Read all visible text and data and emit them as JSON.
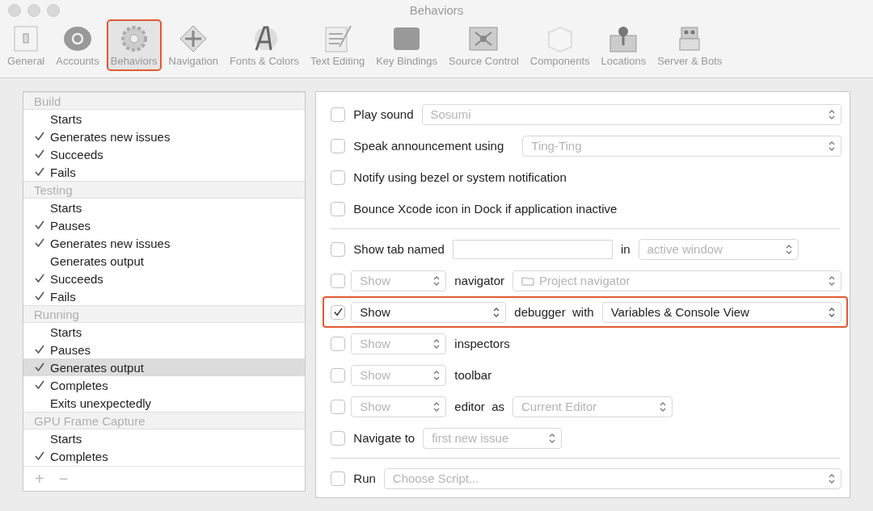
{
  "window": {
    "title": "Behaviors"
  },
  "toolbar": [
    {
      "label": "General",
      "selected": false,
      "highlighted": false
    },
    {
      "label": "Accounts",
      "selected": false,
      "highlighted": false
    },
    {
      "label": "Behaviors",
      "selected": true,
      "highlighted": true
    },
    {
      "label": "Navigation",
      "selected": false,
      "highlighted": false
    },
    {
      "label": "Fonts & Colors",
      "selected": false,
      "highlighted": false
    },
    {
      "label": "Text Editing",
      "selected": false,
      "highlighted": false
    },
    {
      "label": "Key Bindings",
      "selected": false,
      "highlighted": false
    },
    {
      "label": "Source Control",
      "selected": false,
      "highlighted": false
    },
    {
      "label": "Components",
      "selected": false,
      "highlighted": false
    },
    {
      "label": "Locations",
      "selected": false,
      "highlighted": false
    },
    {
      "label": "Server & Bots",
      "selected": false,
      "highlighted": false
    }
  ],
  "event_list": {
    "sections": [
      {
        "title": "Build",
        "items": [
          {
            "label": "Starts",
            "checked": false,
            "selected": false
          },
          {
            "label": "Generates new issues",
            "checked": true,
            "selected": false
          },
          {
            "label": "Succeeds",
            "checked": true,
            "selected": false
          },
          {
            "label": "Fails",
            "checked": true,
            "selected": false
          }
        ]
      },
      {
        "title": "Testing",
        "items": [
          {
            "label": "Starts",
            "checked": false,
            "selected": false
          },
          {
            "label": "Pauses",
            "checked": true,
            "selected": false
          },
          {
            "label": "Generates new issues",
            "checked": true,
            "selected": false
          },
          {
            "label": "Generates output",
            "checked": false,
            "selected": false
          },
          {
            "label": "Succeeds",
            "checked": true,
            "selected": false
          },
          {
            "label": "Fails",
            "checked": true,
            "selected": false
          }
        ]
      },
      {
        "title": "Running",
        "items": [
          {
            "label": "Starts",
            "checked": false,
            "selected": false
          },
          {
            "label": "Pauses",
            "checked": true,
            "selected": false
          },
          {
            "label": "Generates output",
            "checked": true,
            "selected": true
          },
          {
            "label": "Completes",
            "checked": true,
            "selected": false
          },
          {
            "label": "Exits unexpectedly",
            "checked": false,
            "selected": false
          }
        ]
      },
      {
        "title": "GPU Frame Capture",
        "items": [
          {
            "label": "Starts",
            "checked": false,
            "selected": false
          },
          {
            "label": "Completes",
            "checked": true,
            "selected": false
          }
        ]
      }
    ],
    "footer_buttons": [
      "+",
      "−"
    ]
  },
  "actions": [
    {
      "kind": "option",
      "checked": false,
      "highlighted": false,
      "parts": [
        {
          "kind": "label",
          "text": "Play sound"
        },
        {
          "kind": "popup",
          "value": "Sosumi",
          "enabled": false
        }
      ]
    },
    {
      "kind": "option",
      "checked": false,
      "highlighted": false,
      "parts": [
        {
          "kind": "label",
          "text": "Speak announcement using"
        },
        {
          "kind": "spacer"
        },
        {
          "kind": "popup",
          "value": "Ting-Ting",
          "enabled": false
        }
      ]
    },
    {
      "kind": "option",
      "checked": false,
      "highlighted": false,
      "parts": [
        {
          "kind": "label",
          "text": "Notify using bezel or system notification"
        }
      ]
    },
    {
      "kind": "option",
      "checked": false,
      "highlighted": false,
      "parts": [
        {
          "kind": "label",
          "text": "Bounce Xcode icon in Dock if application inactive"
        }
      ]
    },
    {
      "kind": "divider"
    },
    {
      "kind": "option",
      "checked": false,
      "highlighted": false,
      "parts": [
        {
          "kind": "label",
          "text": "Show tab named"
        },
        {
          "kind": "field"
        },
        {
          "kind": "label",
          "text": "in"
        },
        {
          "kind": "medium_popup",
          "value": "active window",
          "enabled": false
        }
      ]
    },
    {
      "kind": "option",
      "checked": false,
      "highlighted": false,
      "parts": [
        {
          "kind": "short_popup",
          "value": "Show",
          "enabled": false
        },
        {
          "kind": "label",
          "text": "navigator"
        },
        {
          "kind": "folder_popup",
          "value": "Project navigator",
          "enabled": false
        }
      ]
    },
    {
      "kind": "option",
      "checked": true,
      "highlighted": true,
      "parts": [
        {
          "kind": "wide_popup",
          "value": "Show",
          "enabled": true
        },
        {
          "kind": "label",
          "text": "debugger  with"
        },
        {
          "kind": "popup",
          "value": "Variables & Console View",
          "enabled": true
        }
      ]
    },
    {
      "kind": "option",
      "checked": false,
      "highlighted": false,
      "parts": [
        {
          "kind": "short_popup",
          "value": "Show",
          "enabled": false
        },
        {
          "kind": "label",
          "text": "inspectors"
        }
      ]
    },
    {
      "kind": "option",
      "checked": false,
      "highlighted": false,
      "parts": [
        {
          "kind": "short_popup",
          "value": "Show",
          "enabled": false
        },
        {
          "kind": "label",
          "text": "toolbar"
        }
      ]
    },
    {
      "kind": "option",
      "checked": false,
      "highlighted": false,
      "parts": [
        {
          "kind": "short_popup",
          "value": "Show",
          "enabled": false
        },
        {
          "kind": "label",
          "text": "editor  as"
        },
        {
          "kind": "medium_popup",
          "value": "Current Editor",
          "enabled": false
        }
      ]
    },
    {
      "kind": "option",
      "checked": false,
      "highlighted": false,
      "parts": [
        {
          "kind": "label",
          "text": "Navigate to"
        },
        {
          "kind": "mid_popup",
          "value": "first new issue",
          "enabled": false
        }
      ]
    },
    {
      "kind": "divider"
    },
    {
      "kind": "option",
      "checked": false,
      "highlighted": false,
      "parts": [
        {
          "kind": "label",
          "text": "Run"
        },
        {
          "kind": "popup",
          "value": "Choose Script...",
          "enabled": false
        }
      ]
    }
  ]
}
